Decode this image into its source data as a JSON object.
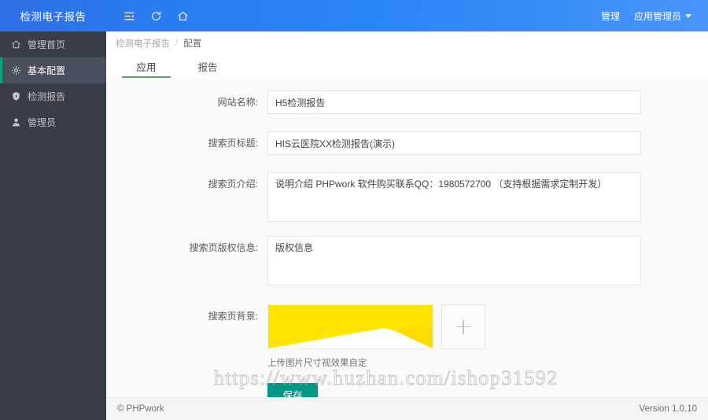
{
  "header": {
    "brand": "检测电子报告",
    "icons": [
      {
        "name": "sidebar-collapse-icon"
      },
      {
        "name": "refresh-icon"
      },
      {
        "name": "home-icon"
      }
    ],
    "right": {
      "manage_label": "管理",
      "user_label": "应用管理员"
    },
    "gradient_from": "#2f6fe8",
    "gradient_to": "#4a95f8"
  },
  "sidebar": {
    "bg": "#393d49",
    "active_bar": "#0aa679",
    "items": [
      {
        "label": "管理首页",
        "icon": "home-icon",
        "active": false
      },
      {
        "label": "基本配置",
        "icon": "gear-icon",
        "active": true
      },
      {
        "label": "检测报告",
        "icon": "shield-icon",
        "active": false
      },
      {
        "label": "管理员",
        "icon": "user-icon",
        "active": false
      }
    ]
  },
  "breadcrumb": {
    "root": "检测电子报告",
    "separator": "/",
    "current": "配置"
  },
  "tabs": [
    {
      "label": "应用",
      "active": true
    },
    {
      "label": "报告",
      "active": false
    }
  ],
  "form": {
    "site_name": {
      "label": "网站名称:",
      "value": "H5检测报告",
      "placeholder": ""
    },
    "search_title": {
      "label": "搜索页标题:",
      "value": "HIS云医院XX检测报告(演示)",
      "placeholder": ""
    },
    "search_intro": {
      "label": "搜索页介绍:",
      "value": "说明介绍 PHPwork 软件购买联系QQ：1980572700 （支持根据需求定制开发）",
      "placeholder": ""
    },
    "search_copyright": {
      "label": "搜索页版权信息:",
      "value": "版权信息",
      "placeholder": ""
    },
    "search_background": {
      "label": "搜索页背景:",
      "hint": "上传图片尺寸视效果自定",
      "add_icon": "plus-icon",
      "thumb_color": "#ffe400"
    },
    "save_button": {
      "label": "保存",
      "color": "#009688"
    }
  },
  "watermark": {
    "text": "https://www.huzhan.com/ishop31592"
  },
  "footer": {
    "left": "© PHPwork",
    "right": "Version 1.0.10"
  }
}
